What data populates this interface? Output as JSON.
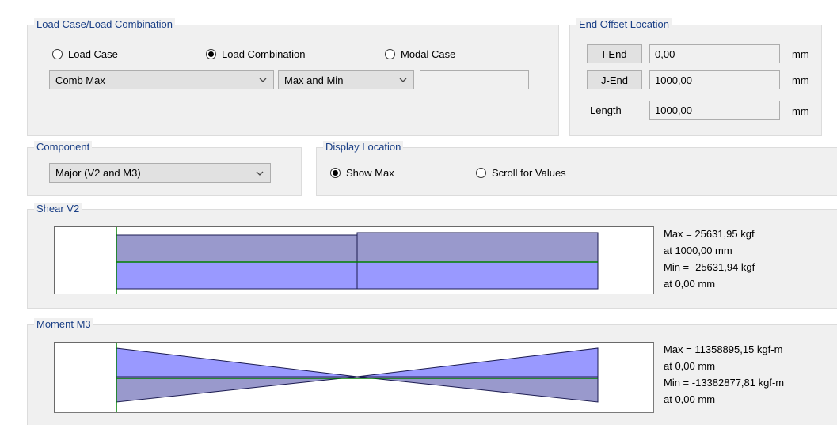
{
  "load_case_group": {
    "title": "Load Case/Load Combination",
    "options": [
      {
        "label": "Load Case",
        "checked": false
      },
      {
        "label": "Load Combination",
        "checked": true
      },
      {
        "label": "Modal Case",
        "checked": false
      }
    ],
    "combination_select": "Comb Max",
    "mode_select": "Max and Min",
    "extra_field": ""
  },
  "end_offset_group": {
    "title": "End Offset Location",
    "i_end": {
      "button": "I-End",
      "value": "0,00",
      "unit": "mm"
    },
    "j_end": {
      "button": "J-End",
      "value": "1000,00",
      "unit": "mm"
    },
    "length": {
      "label": "Length",
      "value": "1000,00",
      "unit": "mm"
    }
  },
  "component_group": {
    "title": "Component",
    "select": "Major (V2 and M3)"
  },
  "display_location_group": {
    "title": "Display Location",
    "options": [
      {
        "label": "Show Max",
        "checked": true
      },
      {
        "label": "Scroll for Values",
        "checked": false
      }
    ]
  },
  "shear": {
    "title": "Shear V2",
    "max_text": "Max = 25631,95 kgf",
    "max_at": "at 1000,00 mm",
    "min_text": "Min = -25631,94 kgf",
    "min_at": "at 0,00 mm"
  },
  "moment": {
    "title": "Moment M3",
    "max_text": "Max = 11358895,15 kgf-m",
    "max_at": "at 0,00 mm",
    "min_text": "Min = -13382877,81 kgf-m",
    "min_at": "at 0,00 mm"
  },
  "colors": {
    "positive_fill": "#9999cc",
    "negative_fill": "#9999ff",
    "baseline": "#008000",
    "title_text": "#1a3f86"
  }
}
